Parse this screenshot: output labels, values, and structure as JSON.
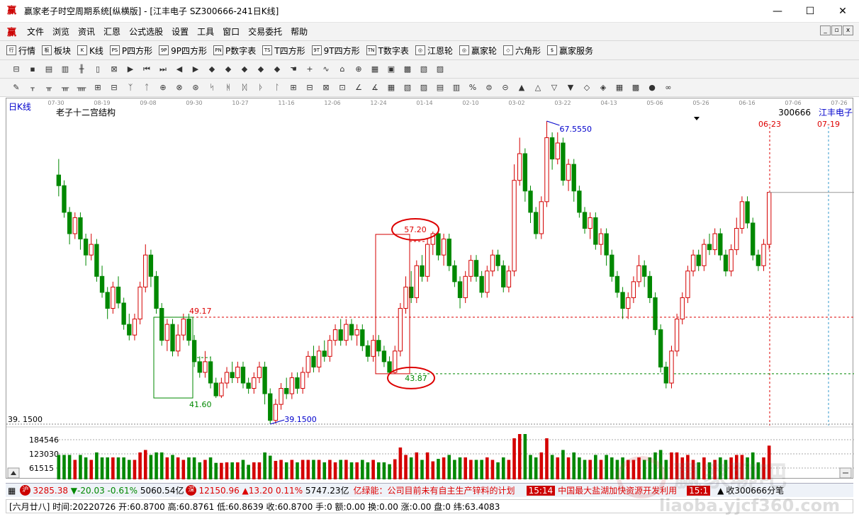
{
  "window": {
    "title": "赢家老子时空周期系统[纵横版] - [江丰电子  SZ300666-241日K线]",
    "app_icon": "赢",
    "minimize": "—",
    "maximize": "☐",
    "close": "✕"
  },
  "menu": {
    "items": [
      "文件",
      "浏览",
      "资讯",
      "汇恩",
      "公式选股",
      "设置",
      "工具",
      "窗口",
      "交易委托",
      "帮助"
    ],
    "icon": "赢"
  },
  "toolbar1": {
    "items": [
      {
        "icon": "行",
        "label": "行情"
      },
      {
        "icon": "板",
        "label": "板块"
      },
      {
        "icon": "K",
        "label": "K线"
      },
      {
        "icon": "PS",
        "label": "P四方形"
      },
      {
        "icon": "9P",
        "label": "9P四方形"
      },
      {
        "icon": "PN",
        "label": "P数字表"
      },
      {
        "icon": "TS",
        "label": "T四方形"
      },
      {
        "icon": "9T",
        "label": "9T四方形"
      },
      {
        "icon": "TN",
        "label": "T数字表"
      },
      {
        "icon": "◎",
        "label": "江恩轮"
      },
      {
        "icon": "◎",
        "label": "赢家轮"
      },
      {
        "icon": "◇",
        "label": "六角形"
      },
      {
        "icon": "$",
        "label": "赢家服务"
      }
    ]
  },
  "chart": {
    "period_label": "日K线",
    "indicator_name": "老子十二宫结构",
    "code": "300666",
    "name": "江丰电子",
    "date_axis": [
      "07-30",
      "08-19",
      "09-08",
      "09-30",
      "10-27",
      "11-16",
      "12-06",
      "12-24",
      "01-14",
      "02-10",
      "03-02",
      "03-22",
      "04-13",
      "05-06",
      "05-26",
      "06-16",
      "07-06",
      "07-26"
    ],
    "future_dates": [
      "06-23",
      "07-19"
    ],
    "low_price_label": "39.1500",
    "low_price_axis": "39. 1500",
    "high_price_label": "67.5550",
    "box1_top": "49.17",
    "box1_bottom": "41.60",
    "box2_top": "57.20",
    "box2_bottom": "43.87",
    "volume_axis": [
      "184546",
      "123030",
      "61515"
    ]
  },
  "chart_data": {
    "type": "candlestick",
    "title": "老子十二宫结构",
    "y_range": [
      39.15,
      67.555
    ],
    "candles": [
      [
        62.5,
        61.5,
        64.0,
        60.5
      ],
      [
        61.5,
        59.0,
        62.0,
        58.5
      ],
      [
        59.0,
        57.0,
        59.5,
        56.0
      ],
      [
        57.0,
        58.5,
        59.0,
        56.5
      ],
      [
        58.5,
        56.5,
        59.0,
        55.5
      ],
      [
        56.5,
        55.0,
        57.0,
        54.0
      ],
      [
        55.0,
        56.0,
        57.0,
        54.5
      ],
      [
        56.0,
        53.0,
        56.5,
        52.5
      ],
      [
        53.0,
        51.5,
        54.0,
        51.0
      ],
      [
        51.5,
        50.0,
        52.0,
        49.0
      ],
      [
        50.0,
        52.0,
        52.5,
        49.5
      ],
      [
        52.0,
        50.5,
        53.0,
        50.0
      ],
      [
        50.5,
        48.5,
        51.0,
        48.0
      ],
      [
        48.5,
        47.5,
        49.5,
        47.0
      ],
      [
        47.5,
        49.0,
        49.5,
        47.0
      ],
      [
        49.0,
        52.0,
        52.5,
        48.5
      ],
      [
        52.0,
        55.0,
        56.0,
        51.5
      ],
      [
        55.0,
        53.0,
        55.5,
        52.0
      ],
      [
        53.0,
        50.0,
        53.5,
        49.5
      ],
      [
        50.0,
        47.0,
        50.5,
        46.5
      ],
      [
        47.0,
        48.5,
        49.0,
        46.0
      ],
      [
        48.5,
        46.0,
        49.0,
        45.5
      ],
      [
        46.0,
        47.5,
        48.5,
        45.5
      ],
      [
        47.5,
        49.0,
        49.5,
        47.0
      ],
      [
        49.0,
        47.0,
        49.5,
        46.5
      ],
      [
        47.0,
        45.0,
        47.5,
        44.5
      ],
      [
        45.0,
        44.0,
        45.5,
        43.5
      ],
      [
        44.0,
        45.0,
        46.0,
        43.5
      ],
      [
        45.0,
        43.0,
        45.5,
        42.5
      ],
      [
        43.0,
        41.8,
        43.5,
        41.6
      ],
      [
        41.8,
        43.0,
        43.5,
        41.6
      ],
      [
        43.0,
        44.0,
        44.5,
        42.5
      ],
      [
        44.0,
        43.5,
        45.0,
        43.0
      ],
      [
        43.5,
        44.5,
        45.0,
        43.0
      ],
      [
        44.5,
        43.0,
        45.0,
        42.5
      ],
      [
        43.0,
        42.5,
        43.5,
        42.0
      ],
      [
        42.5,
        43.5,
        44.0,
        42.0
      ],
      [
        43.5,
        44.5,
        45.0,
        43.0
      ],
      [
        44.5,
        42.0,
        45.0,
        41.0
      ],
      [
        42.0,
        39.5,
        42.5,
        39.15
      ],
      [
        39.5,
        41.0,
        41.5,
        39.2
      ],
      [
        41.0,
        42.5,
        43.0,
        40.5
      ],
      [
        42.5,
        42.0,
        43.5,
        41.5
      ],
      [
        42.0,
        43.5,
        44.0,
        41.5
      ],
      [
        43.5,
        42.5,
        44.0,
        42.0
      ],
      [
        42.5,
        44.0,
        44.5,
        42.0
      ],
      [
        44.0,
        45.5,
        46.0,
        43.5
      ],
      [
        45.5,
        44.5,
        46.5,
        44.0
      ],
      [
        44.5,
        46.0,
        46.5,
        44.0
      ],
      [
        46.0,
        45.5,
        47.0,
        45.0
      ],
      [
        45.5,
        47.0,
        47.5,
        45.0
      ],
      [
        47.0,
        48.0,
        48.5,
        46.5
      ],
      [
        48.0,
        47.0,
        49.0,
        46.5
      ],
      [
        47.0,
        48.5,
        49.0,
        46.5
      ],
      [
        48.5,
        47.5,
        49.0,
        47.0
      ],
      [
        47.5,
        48.0,
        48.5,
        46.5
      ],
      [
        48.0,
        46.5,
        48.5,
        46.0
      ],
      [
        46.5,
        45.5,
        47.0,
        45.0
      ],
      [
        45.5,
        47.0,
        47.5,
        45.0
      ],
      [
        47.0,
        46.0,
        47.5,
        45.5
      ],
      [
        46.0,
        45.0,
        46.5,
        44.5
      ],
      [
        45.0,
        44.0,
        45.5,
        43.87
      ],
      [
        44.0,
        46.0,
        46.5,
        43.87
      ],
      [
        46.0,
        50.0,
        50.5,
        45.5
      ],
      [
        50.0,
        52.0,
        53.0,
        49.5
      ],
      [
        52.0,
        51.0,
        53.5,
        50.5
      ],
      [
        51.0,
        54.0,
        54.5,
        50.5
      ],
      [
        54.0,
        53.0,
        55.0,
        52.5
      ],
      [
        53.0,
        56.0,
        56.5,
        52.5
      ],
      [
        56.0,
        57.0,
        57.2,
        55.0
      ],
      [
        57.0,
        55.0,
        57.2,
        54.5
      ],
      [
        55.0,
        56.5,
        57.0,
        54.0
      ],
      [
        56.5,
        54.0,
        57.0,
        53.5
      ],
      [
        54.0,
        52.5,
        54.5,
        52.0
      ],
      [
        52.5,
        51.0,
        53.0,
        50.0
      ],
      [
        51.0,
        53.0,
        53.5,
        50.5
      ],
      [
        53.0,
        54.5,
        55.0,
        52.5
      ],
      [
        54.5,
        53.0,
        55.0,
        52.5
      ],
      [
        53.0,
        51.5,
        53.5,
        51.0
      ],
      [
        51.5,
        53.5,
        54.0,
        51.0
      ],
      [
        53.5,
        55.0,
        55.5,
        53.0
      ],
      [
        55.0,
        54.0,
        55.5,
        53.5
      ],
      [
        54.0,
        52.0,
        54.5,
        51.5
      ],
      [
        52.0,
        53.5,
        54.0,
        51.5
      ],
      [
        53.5,
        62.0,
        63.5,
        53.0
      ],
      [
        62.0,
        64.5,
        66.0,
        61.5
      ],
      [
        64.5,
        61.0,
        65.0,
        60.0
      ],
      [
        61.0,
        59.0,
        61.5,
        58.0
      ],
      [
        59.0,
        57.0,
        59.5,
        56.5
      ],
      [
        57.0,
        60.0,
        60.5,
        56.5
      ],
      [
        60.0,
        66.0,
        67.555,
        59.5
      ],
      [
        66.0,
        64.0,
        66.5,
        63.0
      ],
      [
        64.0,
        65.5,
        66.5,
        63.5
      ],
      [
        65.5,
        62.0,
        66.0,
        61.5
      ],
      [
        62.0,
        63.5,
        64.0,
        61.0
      ],
      [
        63.5,
        61.0,
        64.0,
        60.0
      ],
      [
        61.0,
        59.0,
        61.5,
        58.5
      ],
      [
        59.0,
        57.5,
        59.5,
        57.0
      ],
      [
        57.5,
        58.5,
        59.0,
        56.5
      ],
      [
        58.5,
        56.0,
        59.0,
        55.5
      ],
      [
        56.0,
        57.0,
        57.5,
        55.0
      ],
      [
        57.0,
        55.0,
        57.5,
        54.0
      ],
      [
        55.0,
        53.0,
        55.5,
        52.5
      ],
      [
        53.0,
        51.5,
        53.5,
        51.0
      ],
      [
        51.5,
        50.0,
        52.0,
        49.0
      ],
      [
        50.0,
        51.0,
        51.5,
        49.0
      ],
      [
        51.0,
        52.5,
        53.0,
        50.5
      ],
      [
        52.5,
        54.0,
        55.0,
        52.0
      ],
      [
        54.0,
        53.0,
        54.5,
        52.0
      ],
      [
        53.0,
        51.0,
        53.5,
        50.5
      ],
      [
        51.0,
        48.0,
        51.5,
        47.5
      ],
      [
        48.0,
        44.5,
        48.5,
        44.0
      ],
      [
        44.5,
        43.0,
        45.0,
        42.5
      ],
      [
        43.0,
        46.0,
        46.5,
        42.5
      ],
      [
        46.0,
        49.0,
        49.5,
        45.5
      ],
      [
        49.0,
        51.0,
        51.5,
        48.5
      ],
      [
        51.0,
        53.5,
        54.0,
        50.5
      ],
      [
        53.5,
        55.0,
        55.5,
        53.0
      ],
      [
        55.0,
        54.0,
        55.5,
        53.5
      ],
      [
        54.0,
        56.0,
        56.5,
        53.5
      ],
      [
        56.0,
        55.5,
        57.0,
        55.0
      ],
      [
        55.5,
        57.0,
        57.5,
        55.0
      ],
      [
        57.0,
        55.0,
        57.5,
        54.5
      ],
      [
        55.0,
        53.5,
        55.5,
        53.0
      ],
      [
        53.5,
        55.5,
        56.0,
        53.0
      ],
      [
        55.5,
        57.5,
        58.5,
        55.0
      ],
      [
        57.5,
        60.0,
        60.5,
        57.0
      ],
      [
        60.0,
        58.0,
        60.5,
        57.5
      ],
      [
        58.0,
        55.0,
        58.5,
        54.5
      ],
      [
        55.0,
        54.0,
        55.5,
        53.5
      ],
      [
        54.0,
        56.0,
        56.5,
        53.5
      ],
      [
        56.0,
        60.87,
        60.88,
        55.5
      ]
    ]
  },
  "statusbar": {
    "sh_icon": "沪",
    "sh_index": "3285.38",
    "sh_change": "▼-20.03",
    "sh_pct": "-0.61%",
    "sh_amount": "5060.54亿",
    "sz_icon": "深",
    "sz_index": "12150.96",
    "sz_change": "▲13.20",
    "sz_pct": "0.11%",
    "sz_amount": "5747.23亿",
    "news1": "亿绿能：公司目前未有自主生产锌料的计划",
    "time1": "15:14",
    "news2": "中国最大盐湖加快资源开发利用",
    "time2": "15:1",
    "right_label": "收300666分笔"
  },
  "infobar": {
    "text": "[六月廿八] 时间:20220726 开:60.8700 高:60.8761 低:60.8639 收:60.8700 手:0 额:0.00 换:0.00 涨:0.00 盘:0 纬:63.4083"
  },
  "watermark": {
    "line1": "赢家聊吧",
    "line2": "liaoba.yjcf360.com"
  },
  "colors": {
    "up": "#d40000",
    "down": "#008800",
    "box_up": "#d40000",
    "box_down": "#008800"
  }
}
